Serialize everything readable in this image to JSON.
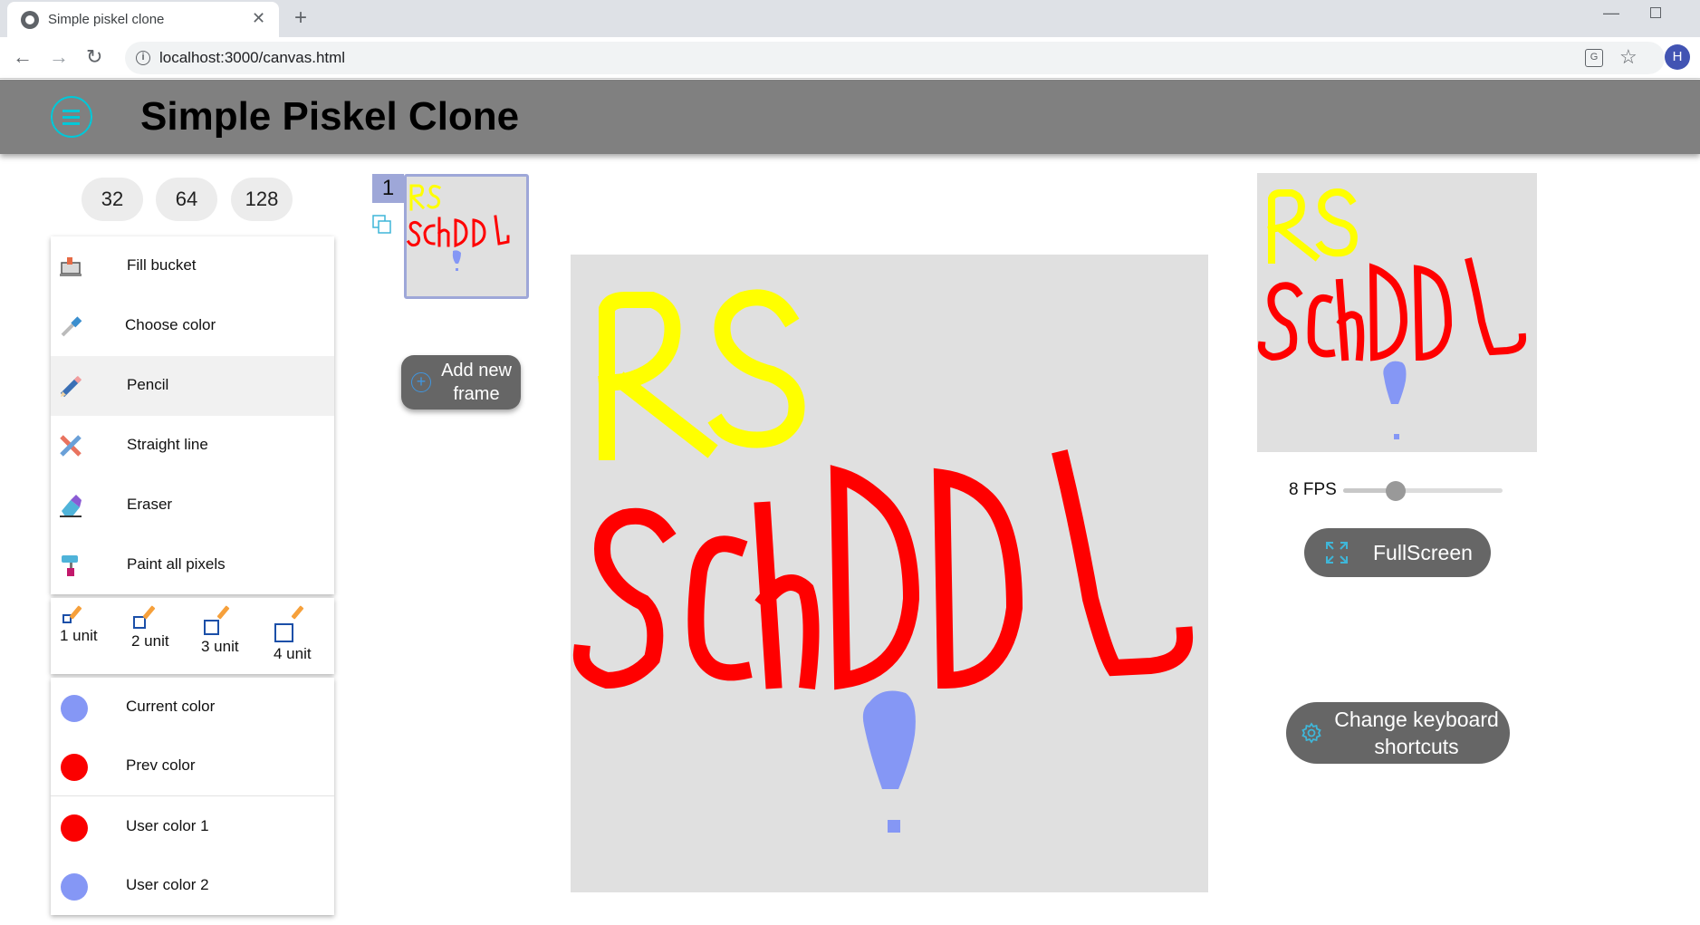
{
  "browser": {
    "tab_title": "Simple piskel clone",
    "url": "localhost:3000/canvas.html",
    "profile_initial": "H"
  },
  "app": {
    "title": "Simple Piskel Clone",
    "accent_color": "#00c8d8"
  },
  "canvas_sizes": [
    "32",
    "64",
    "128"
  ],
  "tools": [
    {
      "label": "Fill bucket",
      "icon": "fill-bucket-icon"
    },
    {
      "label": "Choose color",
      "icon": "eyedropper-icon"
    },
    {
      "label": "Pencil",
      "icon": "pencil-icon",
      "active": true
    },
    {
      "label": "Straight line",
      "icon": "straight-line-icon"
    },
    {
      "label": "Eraser",
      "icon": "eraser-icon"
    },
    {
      "label": "Paint all pixels",
      "icon": "paint-roller-icon"
    }
  ],
  "pen_sizes": [
    "1 unit",
    "2 unit",
    "3 unit",
    "4 unit"
  ],
  "colors": [
    {
      "label": "Current color",
      "color": "#8597f5"
    },
    {
      "label": "Prev color",
      "color": "#fb0000"
    },
    {
      "label": "User color 1",
      "color": "#fb0000"
    },
    {
      "label": "User color 2",
      "color": "#8597f5"
    }
  ],
  "frames": {
    "items": [
      {
        "number": "1"
      }
    ],
    "add_label": "Add new frame"
  },
  "preview": {
    "fps_label": "8 FPS",
    "fps_value": 8,
    "fps_fraction": 0.33,
    "fullscreen_label": "FullScreen"
  },
  "shortcuts_label": "Change keyboard shortcuts",
  "artwork": {
    "text_line_1": "RS",
    "text_line_2": "SChDDL",
    "line_1_color": "#ffff00",
    "line_2_color": "#ff0000",
    "mark_color": "#8597f5",
    "background": "#e0e0e0"
  }
}
